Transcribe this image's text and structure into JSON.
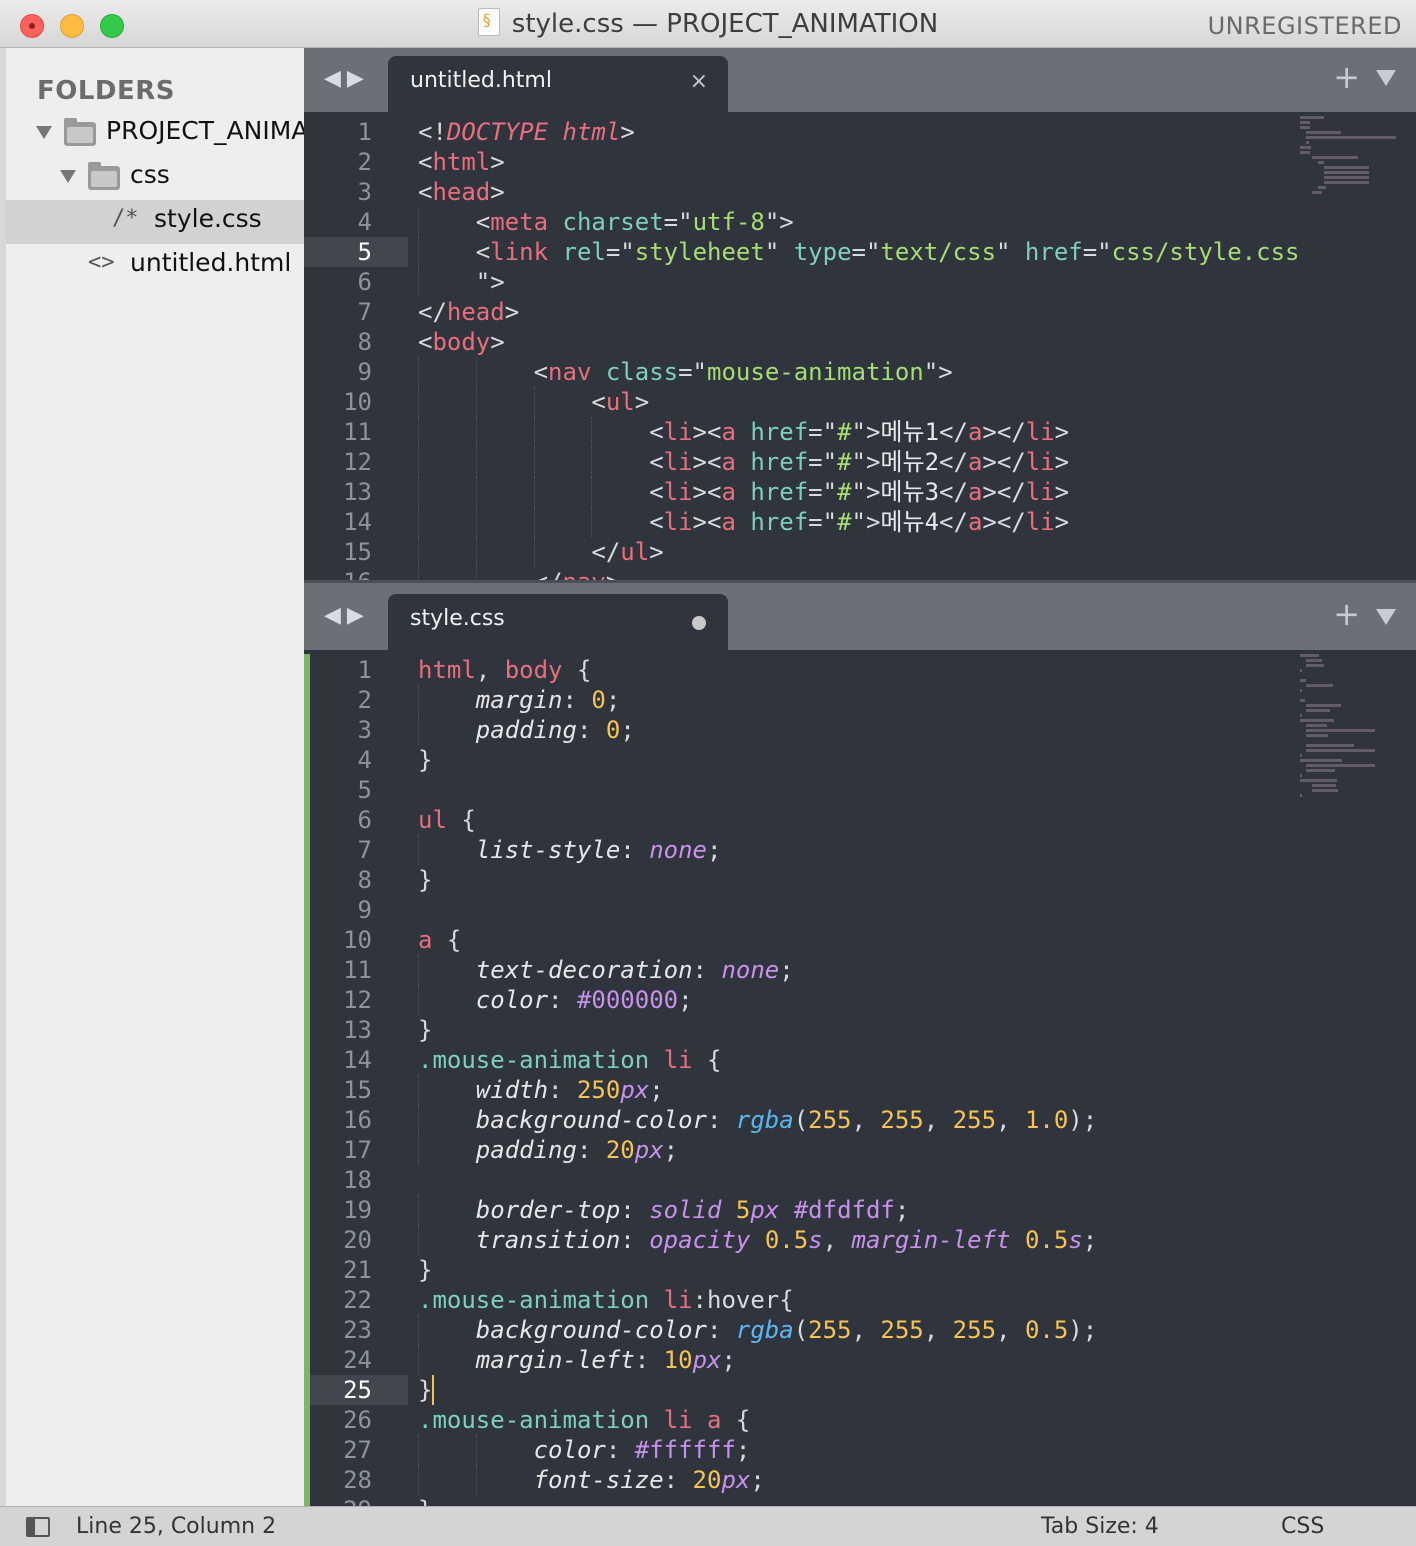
{
  "window": {
    "title": "style.css — PROJECT_ANIMATION",
    "license": "UNREGISTERED"
  },
  "sidebar": {
    "header": "FOLDERS",
    "items": [
      {
        "label": "PROJECT_ANIMAT",
        "type": "folder",
        "expanded": true
      },
      {
        "label": "css",
        "type": "folder",
        "expanded": true
      },
      {
        "label": "style.css",
        "type": "file",
        "glyph": "/*",
        "selected": true
      },
      {
        "label": "untitled.html",
        "type": "file",
        "glyph": "<>"
      }
    ]
  },
  "top_pane": {
    "tab": {
      "label": "untitled.html",
      "close": "×"
    },
    "current_line": 5,
    "lines": [
      {
        "n": "1",
        "indent": 0,
        "tokens": [
          [
            "p",
            "<!"
          ],
          [
            "k",
            "DOCTYPE"
          ],
          [
            "p",
            " "
          ],
          [
            "k",
            "html"
          ],
          [
            "p",
            ">"
          ]
        ]
      },
      {
        "n": "2",
        "indent": 0,
        "tokens": [
          [
            "p",
            "<"
          ],
          [
            "t",
            "html"
          ],
          [
            "p",
            ">"
          ]
        ]
      },
      {
        "n": "3",
        "indent": 0,
        "tokens": [
          [
            "p",
            "<"
          ],
          [
            "t",
            "head"
          ],
          [
            "p",
            ">"
          ]
        ]
      },
      {
        "n": "4",
        "indent": 1,
        "tokens": [
          [
            "p",
            "<"
          ],
          [
            "t",
            "meta"
          ],
          [
            "p",
            " "
          ],
          [
            "a",
            "charset"
          ],
          [
            "p",
            "=\""
          ],
          [
            "s",
            "utf-8"
          ],
          [
            "p",
            "\">"
          ]
        ]
      },
      {
        "n": "5",
        "indent": 1,
        "tokens": [
          [
            "p",
            "<"
          ],
          [
            "t",
            "link"
          ],
          [
            "p",
            " "
          ],
          [
            "a",
            "rel"
          ],
          [
            "p",
            "=\""
          ],
          [
            "s",
            "styleheet"
          ],
          [
            "p",
            "\" "
          ],
          [
            "a",
            "type"
          ],
          [
            "p",
            "=\""
          ],
          [
            "s",
            "text/css"
          ],
          [
            "p",
            "\" "
          ],
          [
            "a",
            "href"
          ],
          [
            "p",
            "=\""
          ],
          [
            "s",
            "css/style.css"
          ]
        ]
      },
      {
        "n": "6",
        "indent": 1,
        "tokens": [
          [
            "p",
            "\">"
          ]
        ]
      },
      {
        "n": "7",
        "indent": 0,
        "tokens": [
          [
            "p",
            "</"
          ],
          [
            "t",
            "head"
          ],
          [
            "p",
            ">"
          ]
        ]
      },
      {
        "n": "8",
        "indent": 0,
        "tokens": [
          [
            "p",
            "<"
          ],
          [
            "t",
            "body"
          ],
          [
            "p",
            ">"
          ]
        ]
      },
      {
        "n": "9",
        "indent": 2,
        "tokens": [
          [
            "p",
            "<"
          ],
          [
            "t",
            "nav"
          ],
          [
            "p",
            " "
          ],
          [
            "a",
            "class"
          ],
          [
            "p",
            "=\""
          ],
          [
            "s",
            "mouse-animation"
          ],
          [
            "p",
            "\">"
          ]
        ]
      },
      {
        "n": "10",
        "indent": 3,
        "tokens": [
          [
            "p",
            "<"
          ],
          [
            "t",
            "ul"
          ],
          [
            "p",
            ">"
          ]
        ]
      },
      {
        "n": "11",
        "indent": 4,
        "tokens": [
          [
            "p",
            "<"
          ],
          [
            "t",
            "li"
          ],
          [
            "p",
            "><"
          ],
          [
            "t",
            "a"
          ],
          [
            "p",
            " "
          ],
          [
            "a",
            "href"
          ],
          [
            "p",
            "=\""
          ],
          [
            "s",
            "#"
          ],
          [
            "p",
            "\">"
          ],
          [
            "ko",
            "메뉴1"
          ],
          [
            "p",
            "</"
          ],
          [
            "t",
            "a"
          ],
          [
            "p",
            "></"
          ],
          [
            "t",
            "li"
          ],
          [
            "p",
            ">"
          ]
        ]
      },
      {
        "n": "12",
        "indent": 4,
        "tokens": [
          [
            "p",
            "<"
          ],
          [
            "t",
            "li"
          ],
          [
            "p",
            "><"
          ],
          [
            "t",
            "a"
          ],
          [
            "p",
            " "
          ],
          [
            "a",
            "href"
          ],
          [
            "p",
            "=\""
          ],
          [
            "s",
            "#"
          ],
          [
            "p",
            "\">"
          ],
          [
            "ko",
            "메뉴2"
          ],
          [
            "p",
            "</"
          ],
          [
            "t",
            "a"
          ],
          [
            "p",
            "></"
          ],
          [
            "t",
            "li"
          ],
          [
            "p",
            ">"
          ]
        ]
      },
      {
        "n": "13",
        "indent": 4,
        "tokens": [
          [
            "p",
            "<"
          ],
          [
            "t",
            "li"
          ],
          [
            "p",
            "><"
          ],
          [
            "t",
            "a"
          ],
          [
            "p",
            " "
          ],
          [
            "a",
            "href"
          ],
          [
            "p",
            "=\""
          ],
          [
            "s",
            "#"
          ],
          [
            "p",
            "\">"
          ],
          [
            "ko",
            "메뉴3"
          ],
          [
            "p",
            "</"
          ],
          [
            "t",
            "a"
          ],
          [
            "p",
            "></"
          ],
          [
            "t",
            "li"
          ],
          [
            "p",
            ">"
          ]
        ]
      },
      {
        "n": "14",
        "indent": 4,
        "tokens": [
          [
            "p",
            "<"
          ],
          [
            "t",
            "li"
          ],
          [
            "p",
            "><"
          ],
          [
            "t",
            "a"
          ],
          [
            "p",
            " "
          ],
          [
            "a",
            "href"
          ],
          [
            "p",
            "=\""
          ],
          [
            "s",
            "#"
          ],
          [
            "p",
            "\">"
          ],
          [
            "ko",
            "메뉴4"
          ],
          [
            "p",
            "</"
          ],
          [
            "t",
            "a"
          ],
          [
            "p",
            "></"
          ],
          [
            "t",
            "li"
          ],
          [
            "p",
            ">"
          ]
        ]
      },
      {
        "n": "15",
        "indent": 3,
        "tokens": [
          [
            "p",
            "</"
          ],
          [
            "t",
            "ul"
          ],
          [
            "p",
            ">"
          ]
        ]
      },
      {
        "n": "16",
        "indent": 2,
        "tokens": [
          [
            "p",
            "</"
          ],
          [
            "t",
            "nav"
          ],
          [
            "p",
            ">"
          ]
        ]
      }
    ]
  },
  "bottom_pane": {
    "tab": {
      "label": "style.css",
      "modified": true
    },
    "current_line": 25,
    "lines": [
      {
        "n": "1",
        "indent": 0,
        "tokens": [
          [
            "sel",
            "html"
          ],
          [
            "p",
            ", "
          ],
          [
            "sel",
            "body"
          ],
          [
            "p",
            " {"
          ]
        ]
      },
      {
        "n": "2",
        "indent": 1,
        "tokens": [
          [
            "prop",
            "margin"
          ],
          [
            "p",
            ": "
          ],
          [
            "num",
            "0"
          ],
          [
            "p",
            ";"
          ]
        ]
      },
      {
        "n": "3",
        "indent": 1,
        "tokens": [
          [
            "prop",
            "padding"
          ],
          [
            "p",
            ": "
          ],
          [
            "num",
            "0"
          ],
          [
            "p",
            ";"
          ]
        ]
      },
      {
        "n": "4",
        "indent": 0,
        "tokens": [
          [
            "p",
            "}"
          ]
        ]
      },
      {
        "n": "5",
        "indent": 0,
        "tokens": []
      },
      {
        "n": "6",
        "indent": 0,
        "tokens": [
          [
            "sel",
            "ul"
          ],
          [
            "p",
            " {"
          ]
        ]
      },
      {
        "n": "7",
        "indent": 1,
        "tokens": [
          [
            "prop",
            "list-style"
          ],
          [
            "p",
            ": "
          ],
          [
            "kw",
            "none"
          ],
          [
            "p",
            ";"
          ]
        ]
      },
      {
        "n": "8",
        "indent": 0,
        "tokens": [
          [
            "p",
            "}"
          ]
        ]
      },
      {
        "n": "9",
        "indent": 0,
        "tokens": []
      },
      {
        "n": "10",
        "indent": 0,
        "tokens": [
          [
            "sel",
            "a"
          ],
          [
            "p",
            " {"
          ]
        ]
      },
      {
        "n": "11",
        "indent": 1,
        "tokens": [
          [
            "prop",
            "text-decoration"
          ],
          [
            "p",
            ": "
          ],
          [
            "kw",
            "none"
          ],
          [
            "p",
            ";"
          ]
        ]
      },
      {
        "n": "12",
        "indent": 1,
        "tokens": [
          [
            "prop",
            "color"
          ],
          [
            "p",
            ": "
          ],
          [
            "hex",
            "#000000"
          ],
          [
            "p",
            ";"
          ]
        ]
      },
      {
        "n": "13",
        "indent": 0,
        "tokens": [
          [
            "p",
            "}"
          ]
        ]
      },
      {
        "n": "14",
        "indent": 0,
        "tokens": [
          [
            "cls",
            ".mouse-animation"
          ],
          [
            "p",
            " "
          ],
          [
            "sel",
            "li"
          ],
          [
            "p",
            " {"
          ]
        ]
      },
      {
        "n": "15",
        "indent": 1,
        "tokens": [
          [
            "prop",
            "width"
          ],
          [
            "p",
            ": "
          ],
          [
            "num",
            "250"
          ],
          [
            "unit",
            "px"
          ],
          [
            "p",
            ";"
          ]
        ]
      },
      {
        "n": "16",
        "indent": 1,
        "tokens": [
          [
            "prop",
            "background-color"
          ],
          [
            "p",
            ": "
          ],
          [
            "fn",
            "rgba"
          ],
          [
            "p",
            "("
          ],
          [
            "num",
            "255"
          ],
          [
            "p",
            ", "
          ],
          [
            "num",
            "255"
          ],
          [
            "p",
            ", "
          ],
          [
            "num",
            "255"
          ],
          [
            "p",
            ", "
          ],
          [
            "num",
            "1.0"
          ],
          [
            "p",
            ");"
          ]
        ]
      },
      {
        "n": "17",
        "indent": 1,
        "tokens": [
          [
            "prop",
            "padding"
          ],
          [
            "p",
            ": "
          ],
          [
            "num",
            "20"
          ],
          [
            "unit",
            "px"
          ],
          [
            "p",
            ";"
          ]
        ]
      },
      {
        "n": "18",
        "indent": 0,
        "tokens": []
      },
      {
        "n": "19",
        "indent": 1,
        "tokens": [
          [
            "prop",
            "border-top"
          ],
          [
            "p",
            ": "
          ],
          [
            "kw",
            "solid"
          ],
          [
            "p",
            " "
          ],
          [
            "num",
            "5"
          ],
          [
            "unit",
            "px"
          ],
          [
            "p",
            " "
          ],
          [
            "hex",
            "#dfdfdf"
          ],
          [
            "p",
            ";"
          ]
        ]
      },
      {
        "n": "20",
        "indent": 1,
        "tokens": [
          [
            "prop",
            "transition"
          ],
          [
            "p",
            ": "
          ],
          [
            "kw",
            "opacity"
          ],
          [
            "p",
            " "
          ],
          [
            "num",
            "0.5"
          ],
          [
            "unit",
            "s"
          ],
          [
            "p",
            ", "
          ],
          [
            "kw",
            "margin-left"
          ],
          [
            "p",
            " "
          ],
          [
            "num",
            "0.5"
          ],
          [
            "unit",
            "s"
          ],
          [
            "p",
            ";"
          ]
        ]
      },
      {
        "n": "21",
        "indent": 0,
        "tokens": [
          [
            "p",
            "}"
          ]
        ]
      },
      {
        "n": "22",
        "indent": 0,
        "tokens": [
          [
            "cls",
            ".mouse-animation"
          ],
          [
            "p",
            " "
          ],
          [
            "sel",
            "li"
          ],
          [
            "p",
            ":hover{"
          ]
        ]
      },
      {
        "n": "23",
        "indent": 1,
        "tokens": [
          [
            "prop",
            "background-color"
          ],
          [
            "p",
            ": "
          ],
          [
            "fn",
            "rgba"
          ],
          [
            "p",
            "("
          ],
          [
            "num",
            "255"
          ],
          [
            "p",
            ", "
          ],
          [
            "num",
            "255"
          ],
          [
            "p",
            ", "
          ],
          [
            "num",
            "255"
          ],
          [
            "p",
            ", "
          ],
          [
            "num",
            "0.5"
          ],
          [
            "p",
            ");"
          ]
        ]
      },
      {
        "n": "24",
        "indent": 1,
        "tokens": [
          [
            "prop",
            "margin-left"
          ],
          [
            "p",
            ": "
          ],
          [
            "num",
            "10"
          ],
          [
            "unit",
            "px"
          ],
          [
            "p",
            ";"
          ]
        ]
      },
      {
        "n": "25",
        "indent": 0,
        "tokens": [
          [
            "p",
            "}"
          ]
        ],
        "cursor": true
      },
      {
        "n": "26",
        "indent": 0,
        "tokens": [
          [
            "cls",
            ".mouse-animation"
          ],
          [
            "p",
            " "
          ],
          [
            "sel",
            "li"
          ],
          [
            "p",
            " "
          ],
          [
            "sel",
            "a"
          ],
          [
            "p",
            " {"
          ]
        ]
      },
      {
        "n": "27",
        "indent": 2,
        "tokens": [
          [
            "prop",
            "color"
          ],
          [
            "p",
            ": "
          ],
          [
            "hex",
            "#ffffff"
          ],
          [
            "p",
            ";"
          ]
        ]
      },
      {
        "n": "28",
        "indent": 2,
        "tokens": [
          [
            "prop",
            "font-size"
          ],
          [
            "p",
            ": "
          ],
          [
            "num",
            "20"
          ],
          [
            "unit",
            "px"
          ],
          [
            "p",
            ";"
          ]
        ]
      },
      {
        "n": "29",
        "indent": 0,
        "tokens": [
          [
            "p",
            "}"
          ]
        ]
      }
    ]
  },
  "statusbar": {
    "position": "Line 25, Column 2",
    "tab_size": "Tab Size: 4",
    "syntax": "CSS"
  }
}
